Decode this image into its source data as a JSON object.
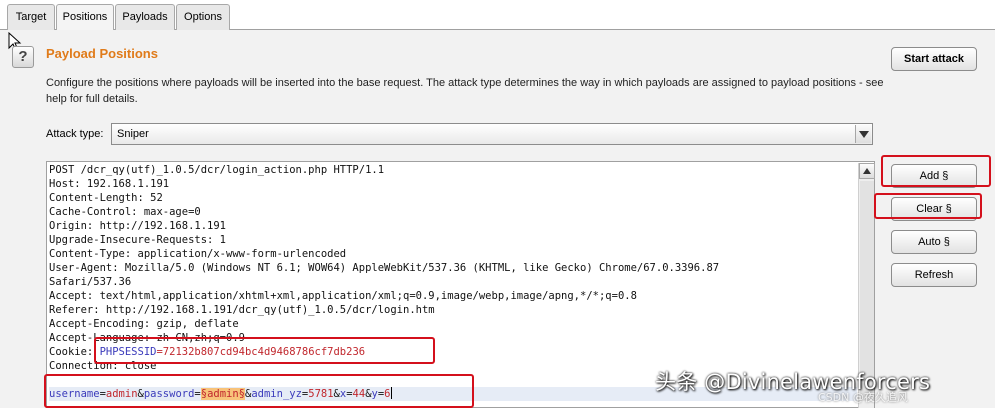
{
  "tabs": [
    {
      "label": "Target"
    },
    {
      "label": "Positions"
    },
    {
      "label": "Payloads"
    },
    {
      "label": "Options"
    }
  ],
  "active_tab": "Positions",
  "header": {
    "title": "Payload Positions",
    "description": "Configure the positions where payloads will be inserted into the base request. The attack type determines the way in which payloads are assigned to payload positions - see help for full details.",
    "help_icon": "?"
  },
  "attack_type": {
    "label": "Attack type:",
    "value": "Sniper"
  },
  "buttons": {
    "start_attack": "Start attack",
    "add": "Add §",
    "clear": "Clear §",
    "auto": "Auto §",
    "refresh": "Refresh"
  },
  "request_lines": [
    "POST /dcr_qy(utf)_1.0.5/dcr/login_action.php HTTP/1.1",
    "Host: 192.168.1.191",
    "Content-Length: 52",
    "Cache-Control: max-age=0",
    "Origin: http://192.168.1.191",
    "Upgrade-Insecure-Requests: 1",
    "Content-Type: application/x-www-form-urlencoded",
    "User-Agent: Mozilla/5.0 (Windows NT 6.1; WOW64) AppleWebKit/537.36 (KHTML, like Gecko) Chrome/67.0.3396.87",
    "Safari/537.36",
    "Accept: text/html,application/xhtml+xml,application/xml;q=0.9,image/webp,image/apng,*/*;q=0.8",
    "Referer: http://192.168.1.191/dcr_qy(utf)_1.0.5/dcr/login.htm",
    "Accept-Encoding: gzip, deflate",
    "Accept-Language: zh-CN,zh;q=0.9"
  ],
  "cookie_line": {
    "prefix": "Cookie: ",
    "name": "PHPSESSID",
    "value": "=72132b807cd94bc4d9468786cf7db236"
  },
  "connection_line": "Connection: close",
  "body_line": {
    "k1": "username",
    "eq1": "=",
    "v1": "admin",
    "amp1": "&",
    "k2": "password",
    "eq2": "=",
    "payload": "§admin§",
    "amp2": "&",
    "k3": "admin_yz",
    "eq3": "=",
    "v3": "5781",
    "amp3": "&",
    "k4": "x",
    "eq4": "=",
    "v4": "44",
    "amp4": "&",
    "k5": "y",
    "eq5": "=",
    "v5": "6"
  },
  "watermark": {
    "text": "头条 @Divinelawenforcers",
    "sub": "CSDN @夜久追风"
  },
  "colors": {
    "title": "#e07b1a",
    "annotation_red": "#d4101c",
    "payload_highlight": "#f8c37a"
  }
}
